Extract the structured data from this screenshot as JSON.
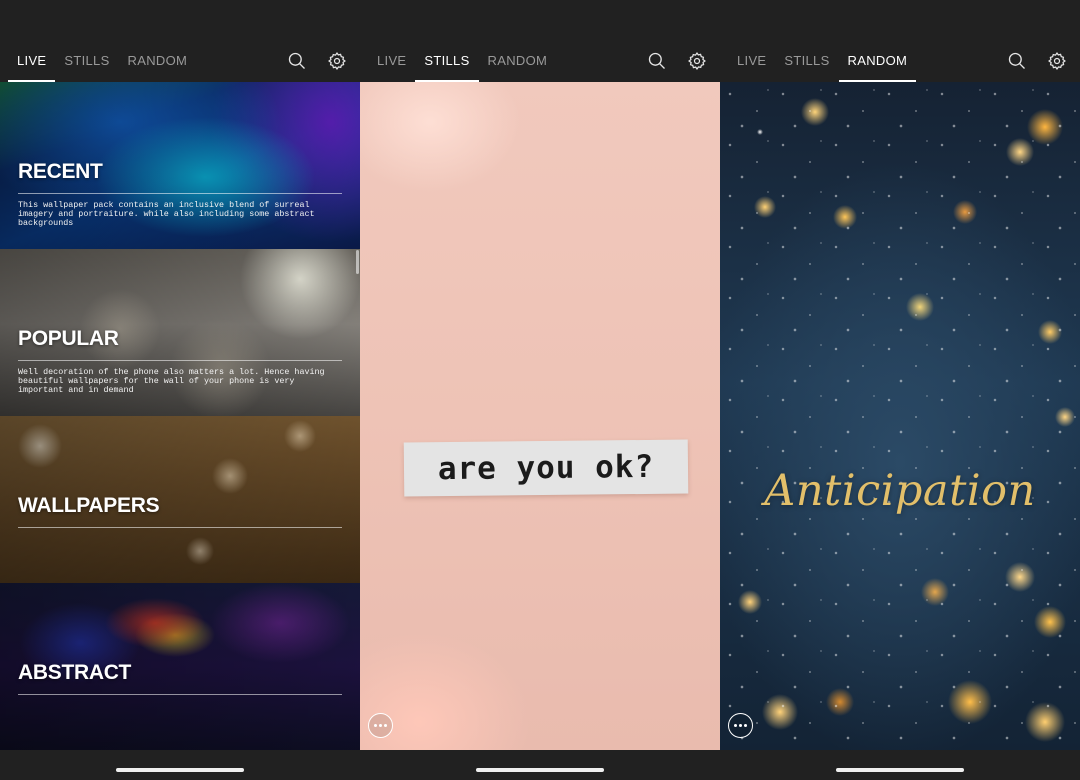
{
  "screens": [
    {
      "tabs": [
        {
          "label": "LIVE",
          "active": true
        },
        {
          "label": "STILLS",
          "active": false
        },
        {
          "label": "RANDOM",
          "active": false
        }
      ],
      "icons": {
        "search": "search-icon",
        "settings": "gear-icon"
      },
      "categories": [
        {
          "title": "RECENT",
          "description": "This wallpaper pack contains an inclusive blend of surreal imagery and portraiture. while also including some abstract backgrounds"
        },
        {
          "title": "POPULAR",
          "description": "Well decoration of the phone also matters a lot. Hence having beautiful wallpapers for the wall of your phone is very important and in demand"
        },
        {
          "title": "WALLPAPERS",
          "description": ""
        },
        {
          "title": "ABSTRACT",
          "description": ""
        }
      ]
    },
    {
      "tabs": [
        {
          "label": "LIVE",
          "active": false
        },
        {
          "label": "STILLS",
          "active": true
        },
        {
          "label": "RANDOM",
          "active": false
        }
      ],
      "icons": {
        "search": "search-icon",
        "settings": "gear-icon",
        "more": "more-options-icon"
      },
      "image_text": "are you ok?"
    },
    {
      "tabs": [
        {
          "label": "LIVE",
          "active": false
        },
        {
          "label": "STILLS",
          "active": false
        },
        {
          "label": "RANDOM",
          "active": true
        }
      ],
      "icons": {
        "search": "search-icon",
        "settings": "gear-icon",
        "more": "more-options-icon"
      },
      "image_text": "Anticipation"
    }
  ],
  "colors": {
    "background": "#212121",
    "tab_active": "#ffffff",
    "tab_inactive": "#9a9a9a",
    "script_gold": "#e2bf6a"
  }
}
